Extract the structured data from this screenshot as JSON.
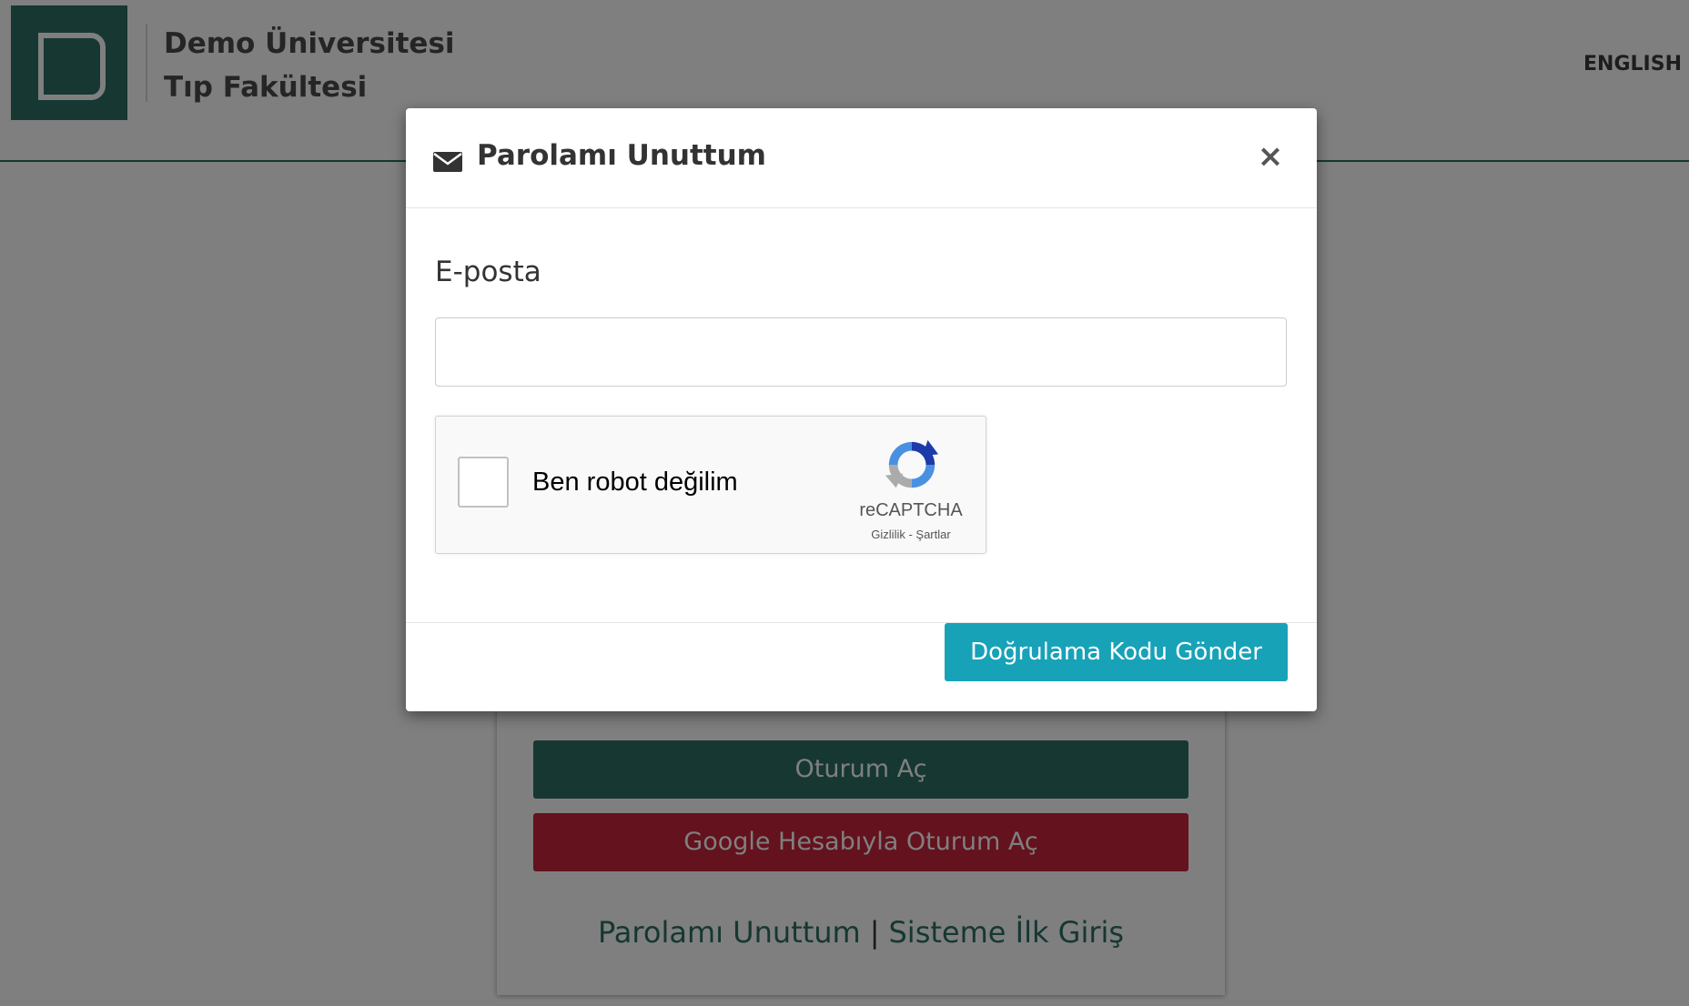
{
  "header": {
    "university_line1": "Demo Üniversitesi",
    "university_line2": "Tıp Fakültesi",
    "language_link": "ENGLISH"
  },
  "login_card": {
    "login_button": "Oturum Aç",
    "google_button": "Google Hesabıyla Oturum Aç",
    "forgot_password_link": "Parolamı Unuttum",
    "separator": "|",
    "first_login_link": "Sisteme İlk Giriş"
  },
  "modal": {
    "title": "Parolamı Unuttum",
    "title_icon": "envelope-icon",
    "close_icon": "close-icon",
    "close_glyph": "×",
    "email_label": "E-posta",
    "email_value": "",
    "recaptcha": {
      "label": "Ben robot değilim",
      "brand": "reCAPTCHA",
      "terms": "Gizlilik - Şartlar",
      "checked": false
    },
    "send_button": "Doğrulama Kodu Gönder"
  },
  "colors": {
    "brand_green": "#2d6e64",
    "google_red": "#c8243a",
    "send_button": "#17a2b8",
    "overlay": "rgba(0,0,0,0.5)"
  }
}
